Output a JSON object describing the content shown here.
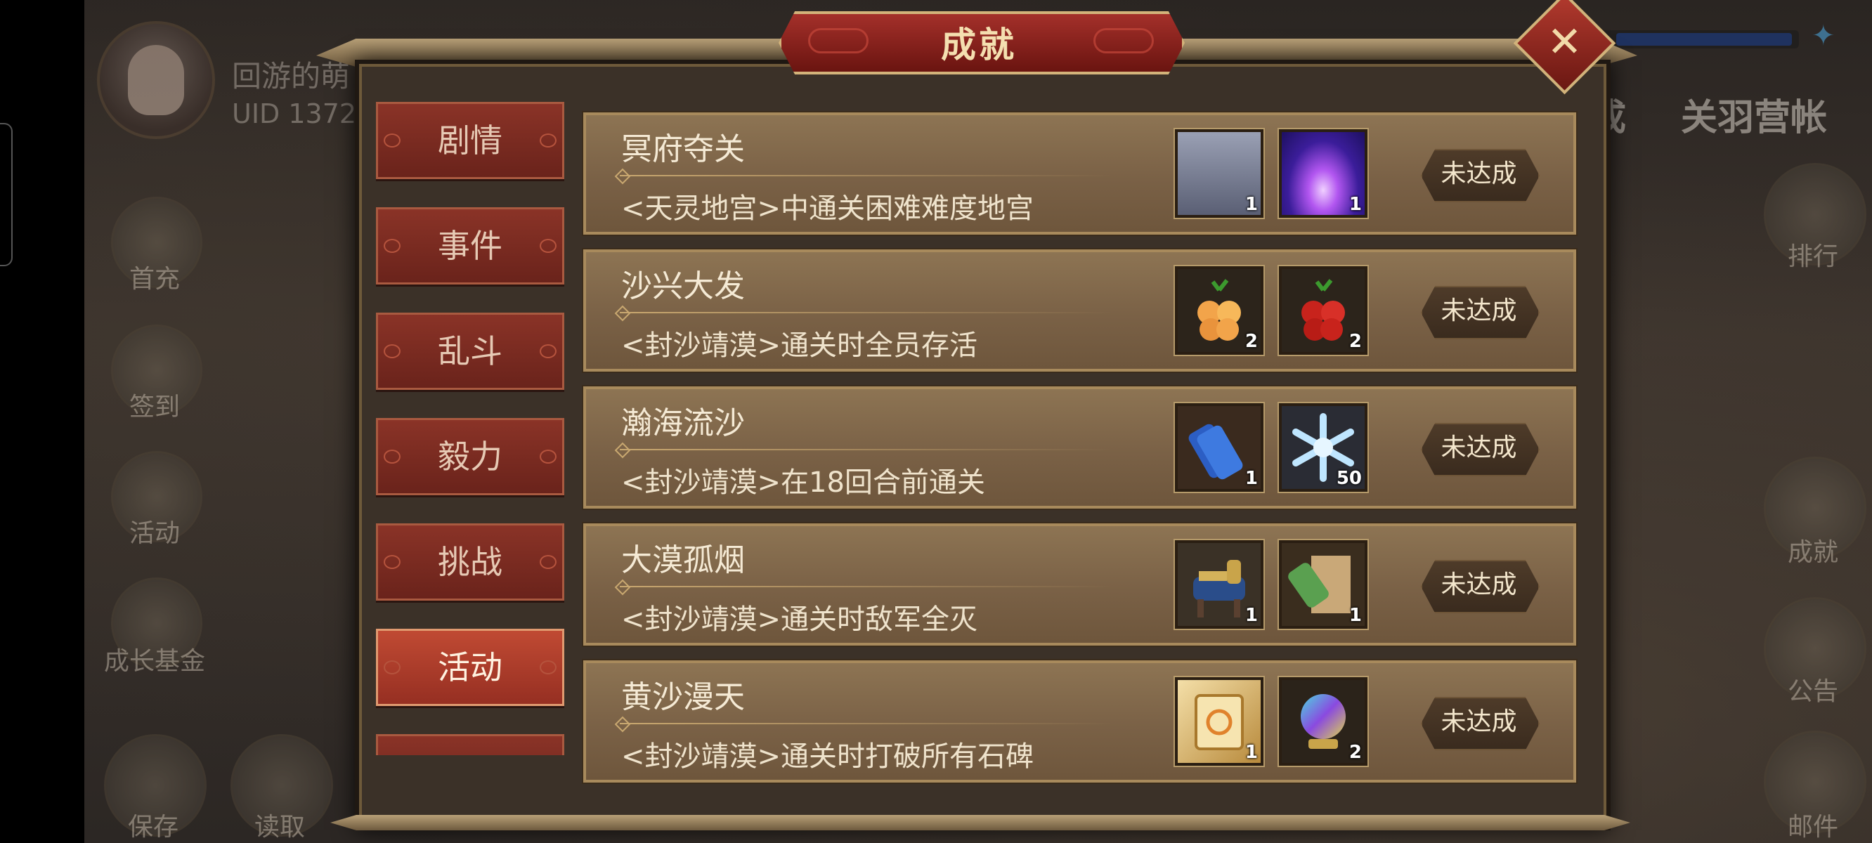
{
  "player": {
    "name": "回游的萌",
    "uid": "UID  1372"
  },
  "left_menu": [
    {
      "label": "首充",
      "icon": "first-recharge-icon"
    },
    {
      "label": "签到",
      "icon": "sign-in-icon"
    },
    {
      "label": "活动",
      "icon": "event-icon"
    },
    {
      "label": "成长基金",
      "icon": "growth-fund-icon"
    }
  ],
  "bottom_left": [
    {
      "label": "保存",
      "icon": "save-icon"
    },
    {
      "label": "读取",
      "icon": "load-icon"
    }
  ],
  "right_menu": [
    {
      "label": "排行",
      "icon": "ranking-icon"
    },
    {
      "label": "成就",
      "icon": "achievement-icon"
    },
    {
      "label": "公告",
      "icon": "notice-icon"
    },
    {
      "label": "邮件",
      "icon": "mail-icon"
    }
  ],
  "top_right_tabs": [
    "成",
    "关羽营帐"
  ],
  "modal": {
    "title": "成就",
    "tabs": [
      "剧情",
      "事件",
      "乱斗",
      "毅力",
      "挑战",
      "活动"
    ],
    "active_tab": "活动",
    "achievements": [
      {
        "name": "冥府夺关",
        "desc": "<天灵地宫>中通关困难难度地宫",
        "rewards": [
          {
            "icon": "treasure-chest-icon",
            "count": "1"
          },
          {
            "icon": "purple-beam-icon",
            "count": "1"
          }
        ],
        "status": "未达成"
      },
      {
        "name": "沙兴大发",
        "desc": "<封沙靖漠>通关时全员存活",
        "rewards": [
          {
            "icon": "peach-fruit-icon",
            "count": "2"
          },
          {
            "icon": "red-cherry-icon",
            "count": "2"
          }
        ],
        "status": "未达成"
      },
      {
        "name": "瀚海流沙",
        "desc": "<封沙靖漠>在18回合前通关",
        "rewards": [
          {
            "icon": "blue-scroll-icon",
            "count": "1"
          },
          {
            "icon": "ice-crystal-icon",
            "count": "50"
          }
        ],
        "status": "未达成"
      },
      {
        "name": "大漠孤烟",
        "desc": "<封沙靖漠>通关时敌军全灭",
        "rewards": [
          {
            "icon": "armored-horse-icon",
            "count": "1"
          },
          {
            "icon": "map-scroll-icon",
            "count": "1"
          }
        ],
        "status": "未达成"
      },
      {
        "name": "黄沙漫天",
        "desc": "<封沙靖漠>通关时打破所有石碑",
        "rewards": [
          {
            "icon": "gold-card-icon",
            "count": "1"
          },
          {
            "icon": "rainbow-orb-icon",
            "count": "2"
          }
        ],
        "status": "未达成"
      }
    ]
  },
  "colors": {
    "title_red": "#a4302a",
    "tab_red": "#8a3327",
    "row_brown": "#7a6146",
    "gold_border": "#d3b37a"
  }
}
